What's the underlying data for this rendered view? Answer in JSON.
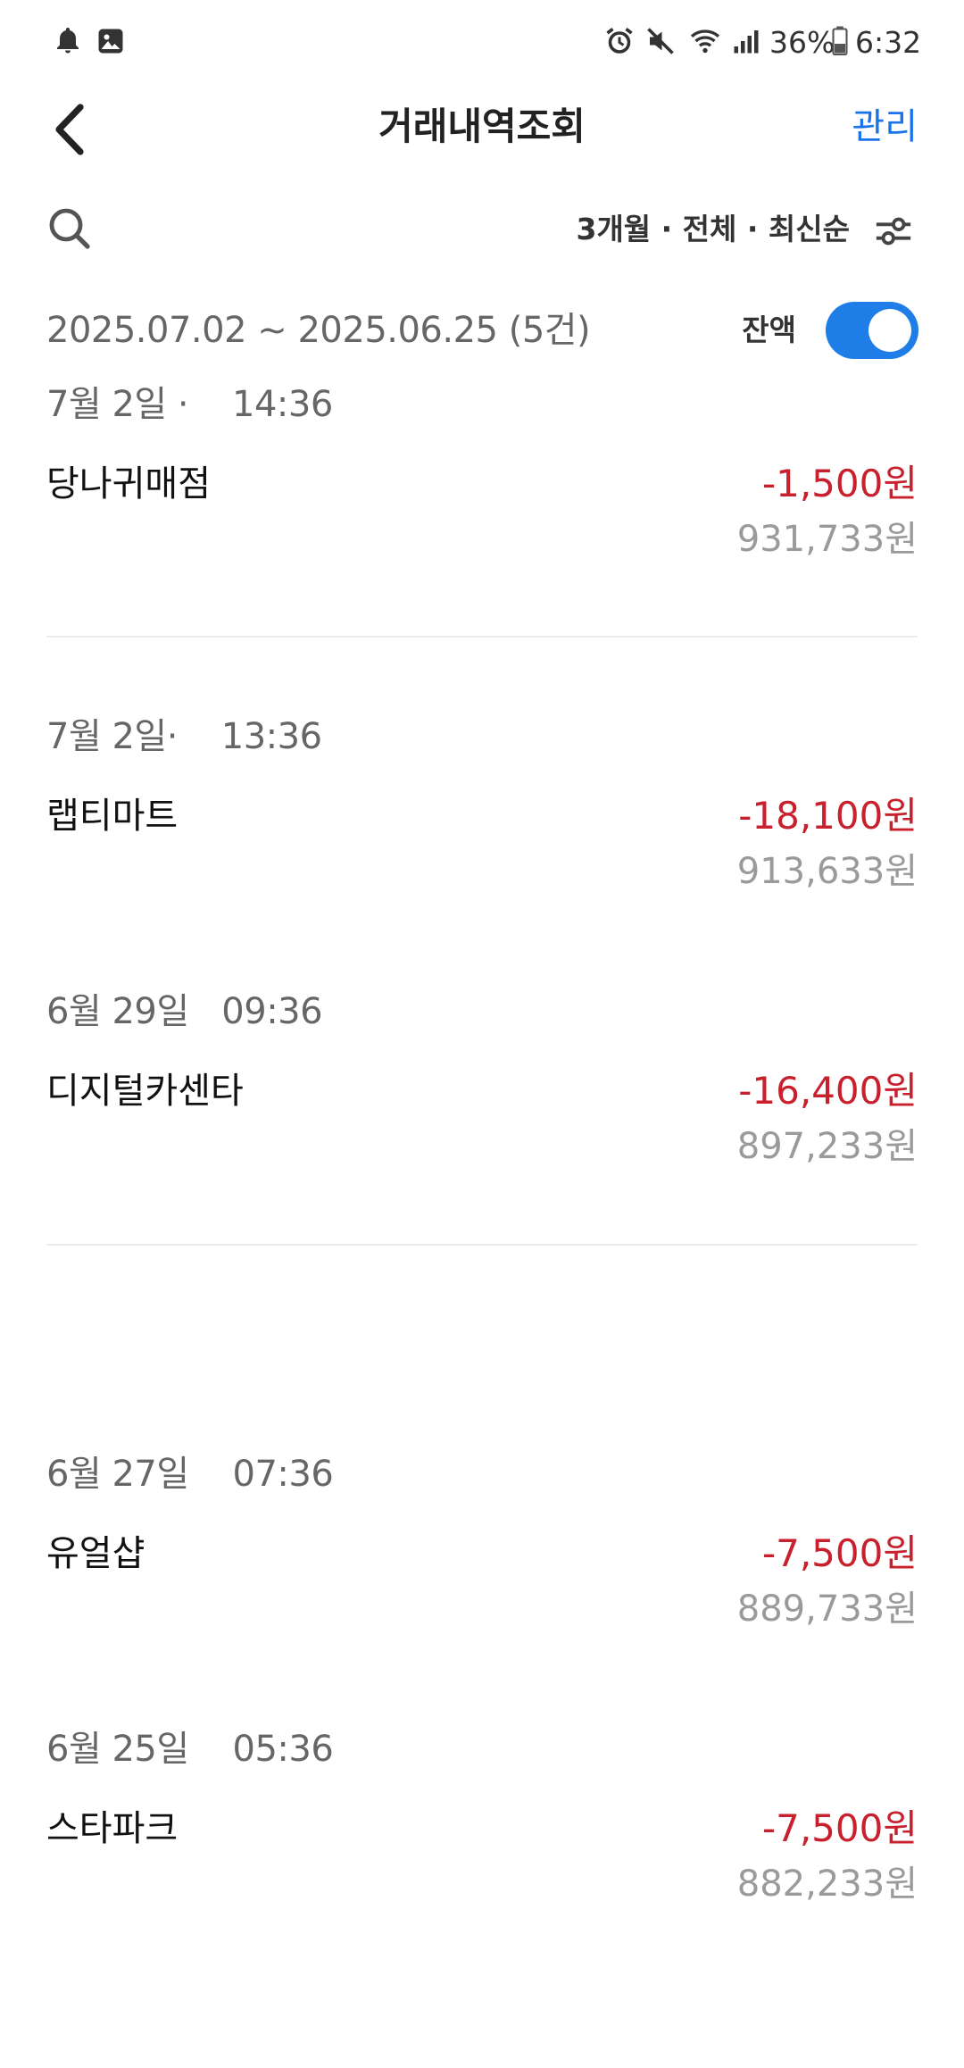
{
  "status_bar": {
    "battery": "36%",
    "time": "6:32",
    "icons": [
      "bell-icon",
      "gallery-icon",
      "alarm-icon",
      "mute-icon",
      "wifi-icon",
      "signal-icon",
      "battery-icon"
    ]
  },
  "header": {
    "title": "거래내역조회",
    "manage_label": "관리",
    "back_icon": "back-chevron-icon"
  },
  "filter": {
    "summary": "3개월 · 전체 · 최신순",
    "search_icon": "search-icon",
    "settings_icon": "filter-sliders-icon"
  },
  "range": {
    "text": "2025.07.02 ~ 2025.06.25 (5건)",
    "balance_label": "잔액",
    "balance_toggle_on": true
  },
  "colors": {
    "accent": "#1e7de6",
    "link": "#1a73e8",
    "withdrawal": "#c8202c",
    "muted": "#9a9a9a"
  },
  "transactions": [
    {
      "date": "7월 2일 ·    14:36",
      "merchant": "당나귀매점",
      "amount": "-1,500원",
      "balance": "931,733원"
    },
    {
      "date": "7월 2일·    13:36",
      "merchant": "랩티마트",
      "amount": "-18,100원",
      "balance": "913,633원"
    },
    {
      "date": "6월 29일   09:36",
      "merchant": "디지털카센타",
      "amount": "-16,400원",
      "balance": "897,233원"
    },
    {
      "date": "6월 27일    07:36",
      "merchant": "유얼샵",
      "amount": "-7,500원",
      "balance": "889,733원"
    },
    {
      "date": "6월 25일    05:36",
      "merchant": "스타파크",
      "amount": "-7,500원",
      "balance": "882,233원"
    }
  ]
}
